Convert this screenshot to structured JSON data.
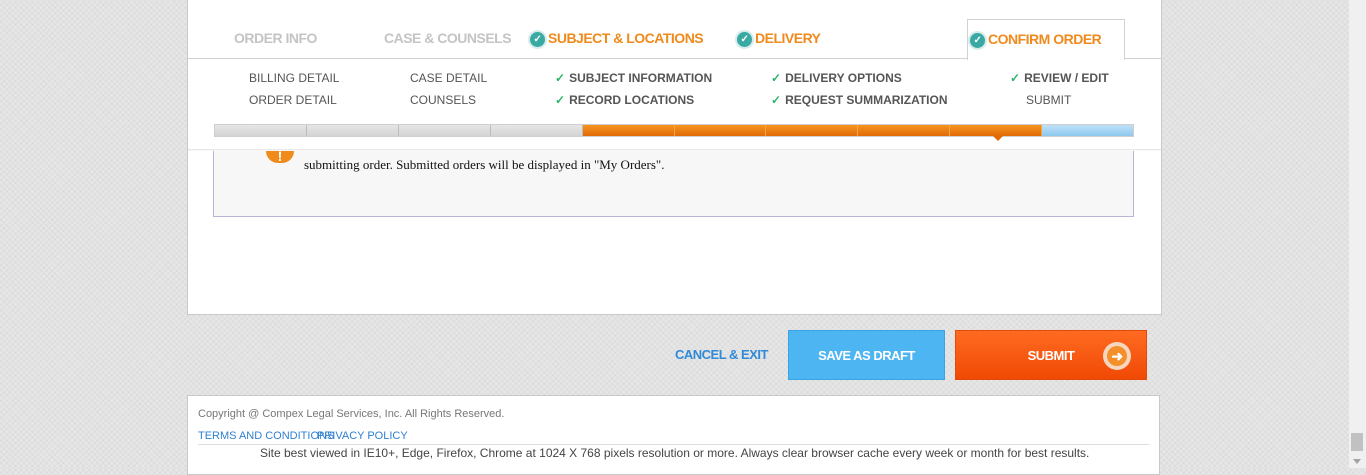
{
  "tabs": [
    {
      "label": "ORDER INFO",
      "done": false
    },
    {
      "label": "CASE & COUNSELS",
      "done": false
    },
    {
      "label": "SUBJECT & LOCATIONS",
      "done": true
    },
    {
      "label": "DELIVERY",
      "done": true
    },
    {
      "label": "CONFIRM ORDER",
      "done": true,
      "active": true
    }
  ],
  "substeps": {
    "order_info": [
      "BILLING DETAIL",
      "ORDER DETAIL"
    ],
    "case_counsels": [
      "CASE DETAIL",
      "COUNSELS"
    ],
    "subject_locations": [
      "SUBJECT INFORMATION",
      "RECORD LOCATIONS"
    ],
    "delivery": [
      "DELIVERY OPTIONS",
      "REQUEST SUMMARIZATION"
    ],
    "confirm_order": [
      "REVIEW / EDIT",
      "SUBMIT"
    ]
  },
  "progress": {
    "segments_total": 10,
    "grey": 4,
    "orange": 5,
    "blue": 1
  },
  "notice": {
    "text": "submitting order. Submitted orders will be displayed in \"My Orders\"."
  },
  "actions": {
    "cancel": "CANCEL & EXIT",
    "draft": "SAVE AS DRAFT",
    "submit": "SUBMIT"
  },
  "footer": {
    "copyright": "Copyright @ Compex Legal Services, Inc. All Rights Reserved.",
    "terms": "TERMS AND CONDITIONS",
    "privacy": "PRIVACY POLICY",
    "note": "Site best viewed in IE10+, Edge, Firefox, Chrome at 1024 X 768 pixels resolution or more. Always clear browser cache every week or month for best results."
  },
  "colors": {
    "accent_orange": "#f08a1c",
    "submit_orange": "#f04a05",
    "draft_blue": "#4eb5f3",
    "link_blue": "#2f8ad8",
    "check_green": "#2bb56a",
    "check_teal": "#3aa9a3"
  }
}
